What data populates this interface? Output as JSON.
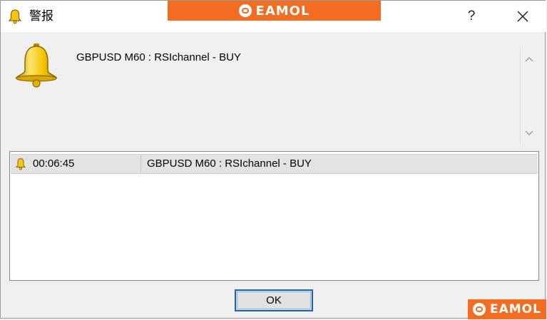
{
  "window": {
    "title": "警报",
    "help_label": "?",
    "close_icon": "close-icon",
    "title_icon": "bell-icon"
  },
  "watermark": {
    "text": "EAMOL",
    "color": "#f26d21"
  },
  "alert": {
    "icon": "bell-icon",
    "message": "GBPUSD M60 : RSIchannel - BUY"
  },
  "list": {
    "rows": [
      {
        "icon": "bell-icon",
        "time": "00:06:45",
        "message": "GBPUSD M60 : RSIchannel - BUY"
      }
    ]
  },
  "buttons": {
    "ok_label": "OK"
  }
}
